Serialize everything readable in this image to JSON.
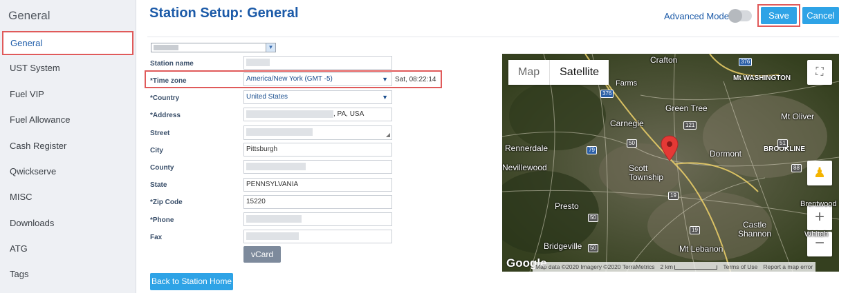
{
  "sidebar": {
    "title": "General",
    "items": [
      {
        "label": "General",
        "active": true
      },
      {
        "label": "UST System"
      },
      {
        "label": "Fuel VIP"
      },
      {
        "label": "Fuel Allowance"
      },
      {
        "label": "Cash Register"
      },
      {
        "label": "Qwickserve"
      },
      {
        "label": "MISC"
      },
      {
        "label": "Downloads"
      },
      {
        "label": "ATG"
      },
      {
        "label": "Tags"
      }
    ]
  },
  "header": {
    "title": "Station Setup: General",
    "advanced_mode_label": "Advanced Mode",
    "advanced_mode_on": false,
    "save_label": "Save",
    "cancel_label": "Cancel"
  },
  "form": {
    "station_name_label": "Station name",
    "timezone_label": "*Time zone",
    "timezone_value": "America/New York (GMT -5)",
    "timezone_time": "Sat, 08:22:14",
    "country_label": "*Country",
    "country_value": "United States",
    "address_label": "*Address",
    "address_suffix": ", PA, USA",
    "street_label": "Street",
    "city_label": "City",
    "city_value": "Pittsburgh",
    "county_label": "County",
    "state_label": "State",
    "state_value": "PENNSYLVANIA",
    "zip_label": "*Zip Code",
    "zip_value": "15220",
    "phone_label": "*Phone",
    "fax_label": "Fax",
    "vcard_label": "vCard",
    "back_label": "Back to Station Home"
  },
  "map": {
    "type_map": "Map",
    "type_satellite": "Satellite",
    "selected_type": "Satellite",
    "places": [
      "Crafton",
      "Mt WASHINGTON",
      "Green Tree",
      "Mt Oliver",
      "Carnegie",
      "Rennerdale",
      "Dormont",
      "BROOKLINE",
      "Nevillewood",
      "Scott Township",
      "Presto",
      "Brentwood",
      "Castle Shannon",
      "Bridgeville",
      "Mt Lebanon",
      "Whiteh",
      "Farms"
    ],
    "roads": [
      "376",
      "79",
      "50",
      "121",
      "51",
      "19",
      "88"
    ],
    "attribution": "Map data ©2020 Imagery ©2020 TerraMetrics",
    "scale_label": "2 km",
    "terms": "Terms of Use",
    "report": "Report a map error",
    "logo": "Google"
  },
  "colors": {
    "accent": "#1b5aa8",
    "button": "#2ea3e6",
    "highlight": "#e05a5a",
    "marker": "#e53935"
  }
}
